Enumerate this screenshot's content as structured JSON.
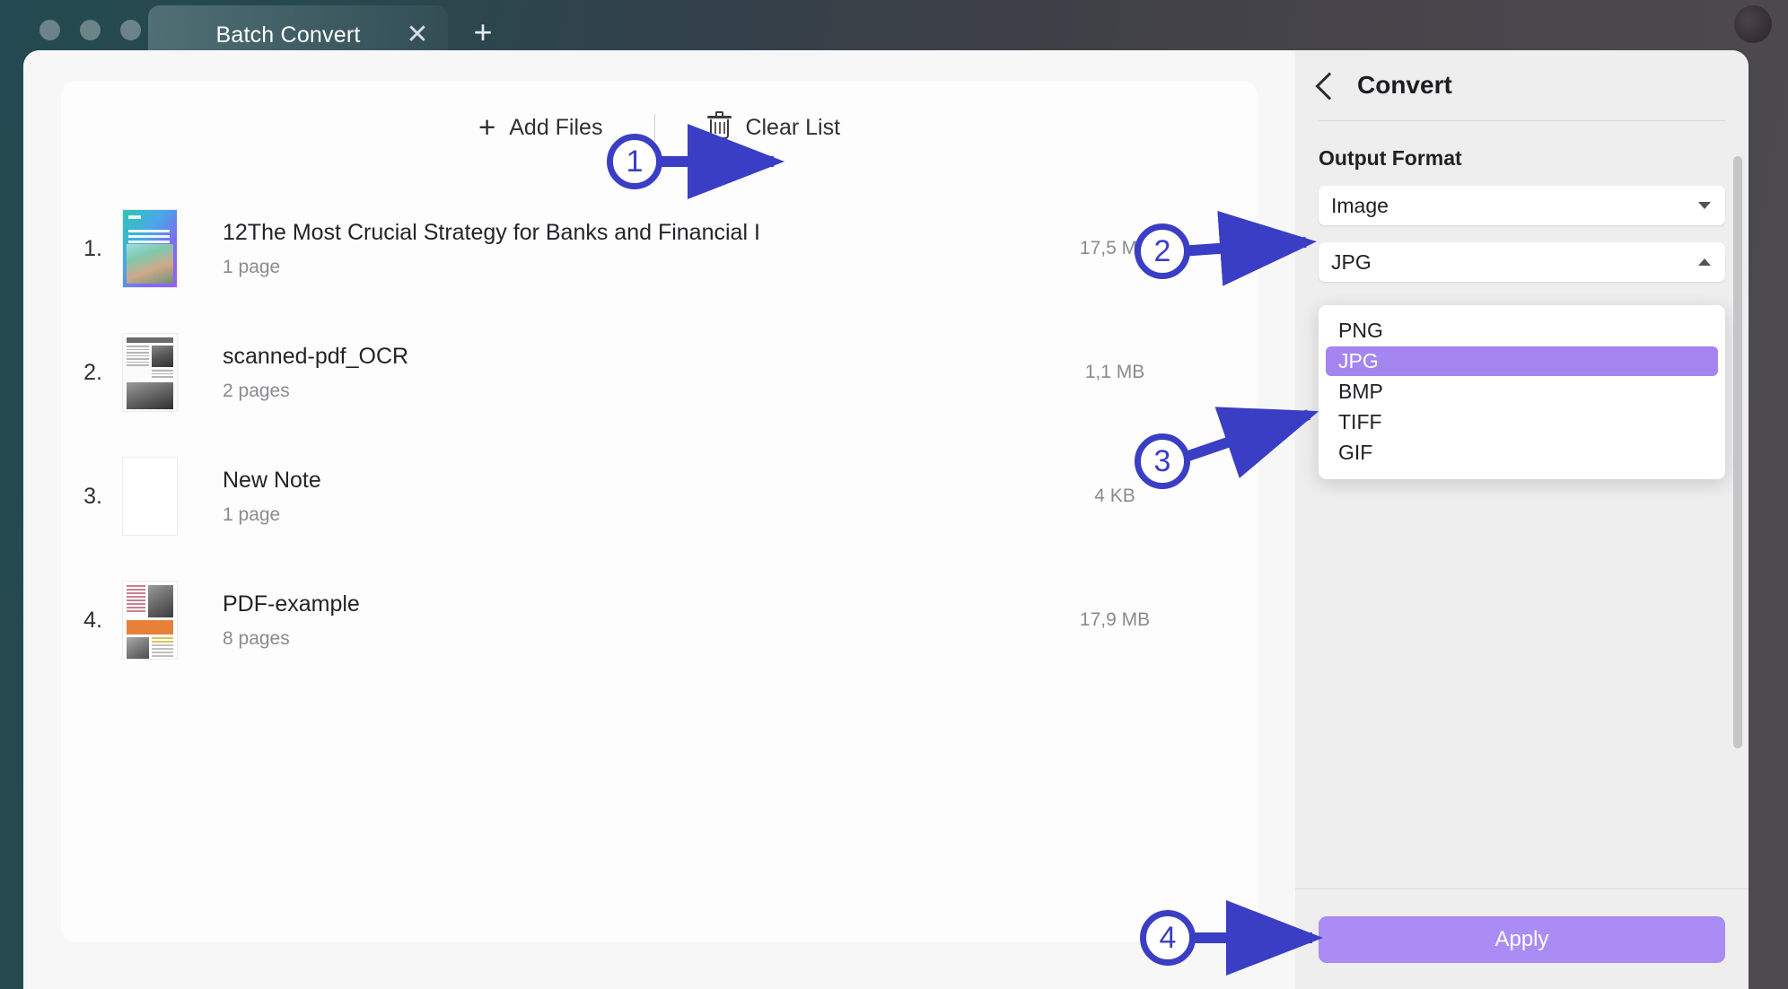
{
  "window": {
    "tab_title": "Batch Convert",
    "close_icon": "close-icon",
    "new_tab_icon": "plus-icon",
    "avatar": "user-avatar"
  },
  "toolbar": {
    "add_files_label": "Add Files",
    "add_files_icon": "plus-icon",
    "clear_list_label": "Clear List",
    "clear_list_icon": "trash-icon"
  },
  "file_list": [
    {
      "index": "1.",
      "name": "12The Most Crucial Strategy for Banks and Financial I",
      "pages": "1 page",
      "size": "17,5 MB",
      "thumb": "gradient-cover"
    },
    {
      "index": "2.",
      "name": "scanned-pdf_OCR",
      "pages": "2 pages",
      "size": "1,1 MB",
      "thumb": "newspaper-scan"
    },
    {
      "index": "3.",
      "name": "New Note",
      "pages": "1 page",
      "size": "4 KB",
      "thumb": "blank-page"
    },
    {
      "index": "4.",
      "name": "PDF-example",
      "pages": "8 pages",
      "size": "17,9 MB",
      "thumb": "magazine-page"
    }
  ],
  "panel": {
    "back_icon": "chevron-left-icon",
    "title": "Convert",
    "output_format_label": "Output Format",
    "format_category_value": "Image",
    "format_category_caret": "chevron-down-icon",
    "image_format_value": "JPG",
    "image_format_caret": "chevron-up-icon",
    "dropdown_options": [
      "PNG",
      "JPG",
      "BMP",
      "TIFF",
      "GIF"
    ],
    "dropdown_selected": "JPG",
    "apply_label": "Apply"
  },
  "annotations": [
    {
      "number": "1"
    },
    {
      "number": "2"
    },
    {
      "number": "3"
    },
    {
      "number": "4"
    }
  ],
  "colors": {
    "accent_purple": "#ab8cf5",
    "highlight_purple": "#a585f0",
    "annotation_blue": "#3a3ec4",
    "panel_bg": "#eeeeef",
    "app_bg": "#f7f7f8"
  }
}
